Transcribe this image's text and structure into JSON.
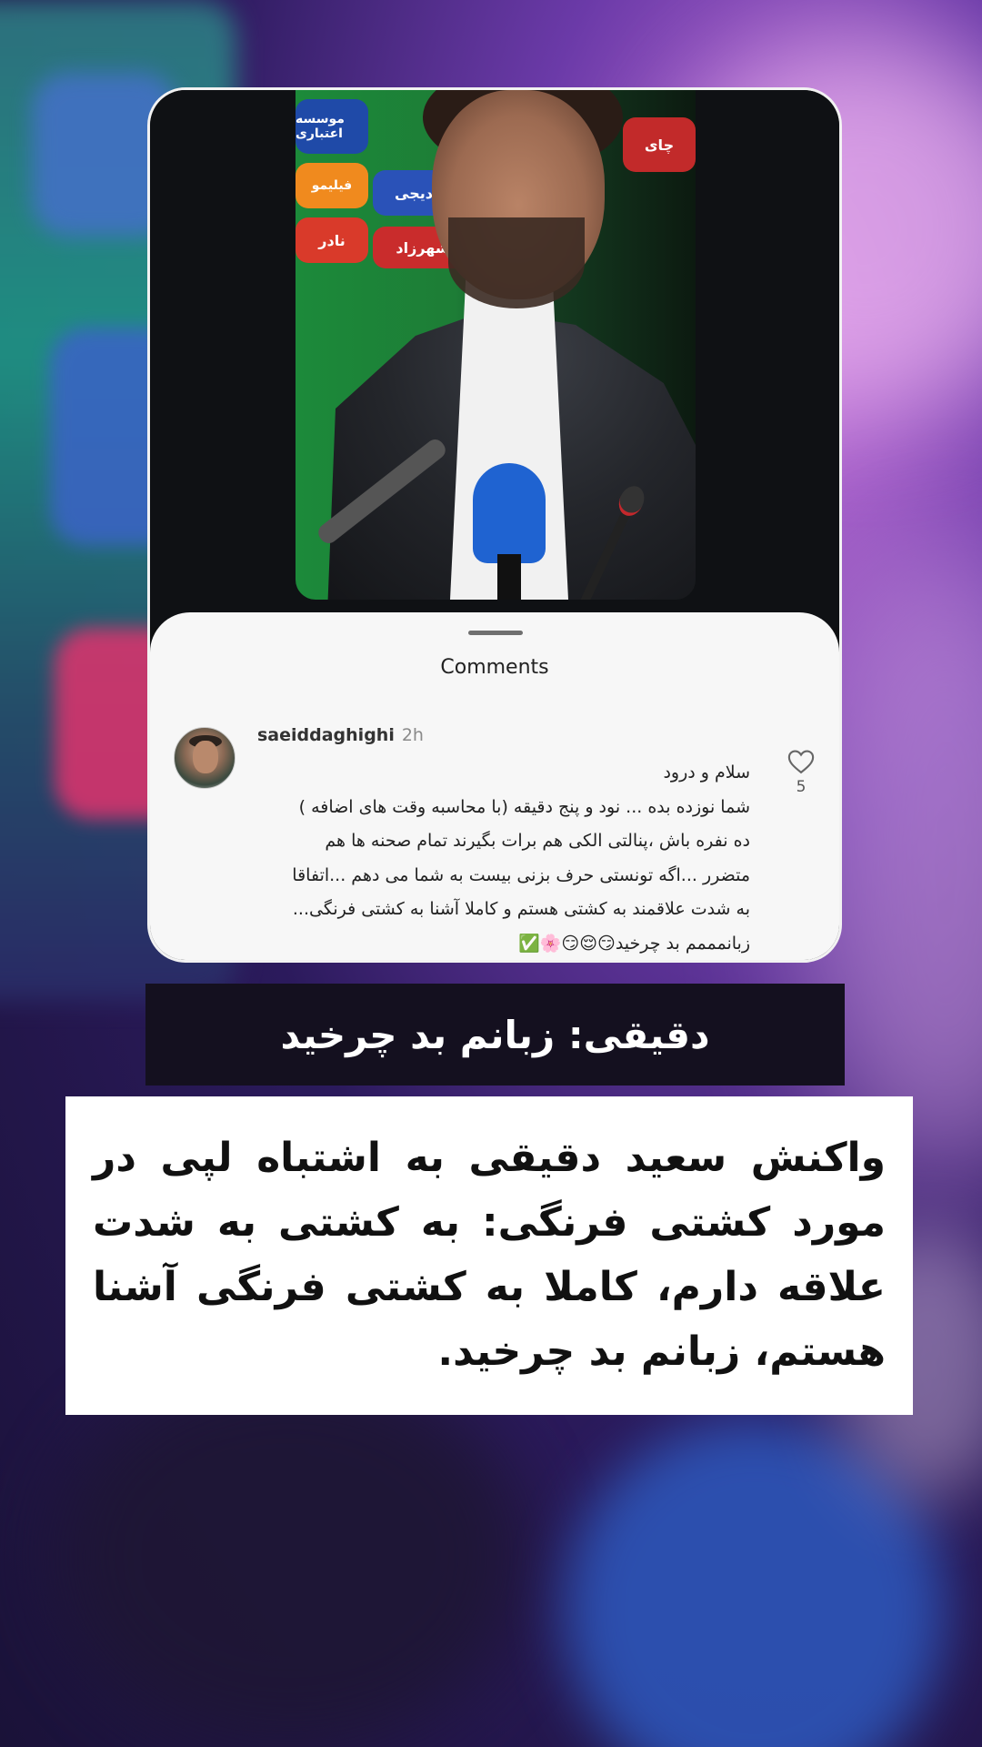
{
  "video": {
    "sponsor_signs": [
      "موسسه اعتباری",
      "فیلیمو",
      "چای",
      "نادر",
      "شهرزاد",
      "دیجی"
    ]
  },
  "comments_sheet": {
    "title": "Comments",
    "comment": {
      "username": "saeiddaghighi",
      "time": "2h",
      "lines": [
        "سلام و درود",
        "شما نوزده بده ... نود و پنج دقیقه (با محاسبه وقت های اضافه )",
        "ده نفره باش ،پنالتی الکی هم برات بگیرند تمام صحنه ها هم",
        "متضرر ...اگه تونستی حرف بزنی بیست به شما می دهم ...اتفاقا",
        "به شدت علاقمند به کشتی هستم و کاملا آشنا به کشتی فرنگی...",
        "زبانمممم بد چرخید😏😌😏🌸✅"
      ],
      "likes": "5"
    }
  },
  "headline": "دقیقی: زبانم بد چرخید",
  "caption": "واکنش سعید دقیقی به اشتباه لپی در مورد کشتی فرنگی: به کشتی به شدت علاقه دارم، کاملا به کشتی فرنگی آشنا هستم، زبانم بد چرخید.",
  "colors": {
    "card_border": "#f2f2f2",
    "sheet_bg": "#f7f7f7",
    "headline_band": "#14101f",
    "caption_bg": "#ffffff"
  }
}
